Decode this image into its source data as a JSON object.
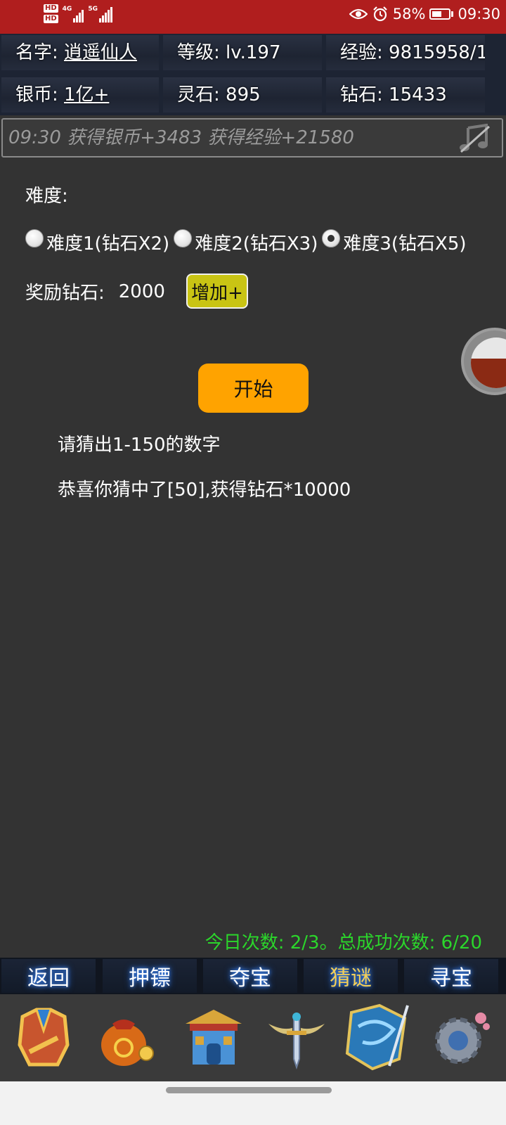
{
  "status_bar": {
    "hd1": "HD",
    "hd2": "HD",
    "net1": "4G",
    "net2": "5G",
    "battery_percent": "58%",
    "battery_level": 0.58,
    "time": "09:30"
  },
  "player": {
    "name_label": "名字: ",
    "name_value": "逍遥仙人",
    "level_label": "等级: ",
    "level_value": "lv.197",
    "exp_label": "经验: ",
    "exp_value": "9815958/1",
    "silver_label": "银币: ",
    "silver_value": "1亿+",
    "spirit_label": "灵石: ",
    "spirit_value": "895",
    "diamond_label": "钻石: ",
    "diamond_value": "15433"
  },
  "log": {
    "text": "09:30 获得银币+3483 获得经验+21580"
  },
  "game": {
    "difficulty_label": "难度:",
    "options": [
      {
        "label": "难度1(钻石X2)",
        "checked": false
      },
      {
        "label": "难度2(钻石X3)",
        "checked": false
      },
      {
        "label": "难度3(钻石X5)",
        "checked": true
      }
    ],
    "reward_label": "奖励钻石:",
    "reward_value": "2000",
    "add_label": "增加+",
    "start_label": "开始",
    "hint": "请猜出1-150的数字",
    "result": "恭喜你猜中了[50],获得钻石*10000",
    "counts": "今日次数: 2/3。总成功次数: 6/20"
  },
  "tabs": [
    {
      "label": "返回",
      "active": false
    },
    {
      "label": "押镖",
      "active": false
    },
    {
      "label": "夺宝",
      "active": false
    },
    {
      "label": "猜谜",
      "active": true
    },
    {
      "label": "寻宝",
      "active": false
    }
  ],
  "bottom_icons": [
    "armor-icon",
    "treasure-bag-icon",
    "shop-building-icon",
    "sword-wings-icon",
    "skill-shield-icon",
    "settings-gear-icon"
  ],
  "colors": {
    "status_bar": "#b01e1e",
    "background": "#333333",
    "start_button": "#ffa300",
    "add_button": "#c9c414",
    "counts_text": "#2bd62b",
    "active_tab": "#f4cf57"
  }
}
